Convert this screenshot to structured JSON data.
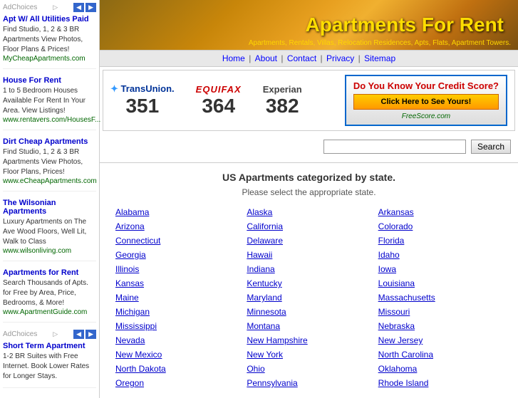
{
  "header": {
    "title": "Apartments For Rent",
    "subtitle": "Apartments, Rentals, Villas, Relocation Residences, Apts, Flats, Apartment Towers."
  },
  "navbar": {
    "items": [
      "Home",
      "About",
      "Contact",
      "Privacy",
      "Sitemap"
    ]
  },
  "credit": {
    "banner_title": "Do You Know Your Credit Score?",
    "cta_btn": "Click Here to See Yours!",
    "freescore": "FreeScore.com",
    "scores": [
      {
        "brand": "TransUnion.",
        "value": "351",
        "class": "transunion"
      },
      {
        "brand": "EQUIFAX",
        "value": "364",
        "class": "equifax"
      },
      {
        "brand": "Experian",
        "value": "382",
        "class": "experian"
      }
    ]
  },
  "search": {
    "placeholder": "",
    "button": "Search"
  },
  "states": {
    "title": "US Apartments categorized by state.",
    "subtitle": "Please select the appropriate state.",
    "list": [
      [
        "Alabama",
        "Alaska",
        "Arkansas"
      ],
      [
        "Arizona",
        "California",
        "Colorado"
      ],
      [
        "Connecticut",
        "Delaware",
        "Florida"
      ],
      [
        "Georgia",
        "Hawaii",
        "Idaho"
      ],
      [
        "Illinois",
        "Indiana",
        "Iowa"
      ],
      [
        "Kansas",
        "Kentucky",
        "Louisiana"
      ],
      [
        "Maine",
        "Maryland",
        "Massachusetts"
      ],
      [
        "Michigan",
        "Minnesota",
        "Missouri"
      ],
      [
        "Mississippi",
        "Montana",
        "Nebraska"
      ],
      [
        "Nevada",
        "New Hampshire",
        "New Jersey"
      ],
      [
        "New Mexico",
        "New York",
        "North Carolina"
      ],
      [
        "North Dakota",
        "Ohio",
        "Oklahoma"
      ],
      [
        "Oregon",
        "Pennsylvania",
        "Rhode Island"
      ]
    ]
  },
  "sidebar": {
    "adchoices_label": "AdChoices",
    "ads": [
      {
        "title": "Apt W/ All Utilities Paid",
        "text": "Find Studio, 1, 2 & 3 BR Apartments View Photos, Floor Plans & Prices!",
        "link": "MyCheapApartments.com"
      },
      {
        "title": "House For Rent",
        "text": "1 to 5 Bedroom Houses Available For Rent In Your Area. View Listings!",
        "link": "www.rentavers.com/HousesF..."
      },
      {
        "title": "Dirt Cheap Apartments",
        "text": "Find Studio, 1, 2 & 3 BR Apartments View Photos, Floor Plans, Prices!",
        "link": "www.eCheapApartments.com"
      },
      {
        "title": "The Wilsonian Apartments",
        "text": "Luxury Apartments on The Ave Wood Floors, Well Lit, Walk to Class",
        "link": "www.wilsonliving.com"
      },
      {
        "title": "Apartments for Rent",
        "text": "Search Thousands of Apts. for Free by Area, Price, Bedrooms, & More!",
        "link": "www.ApartmentGuide.com"
      }
    ],
    "ads2": [
      {
        "title": "Short Term Apartment",
        "text": "1-2 BR Suites with Free Internet. Book Lower Rates for Longer Stays.",
        "link": ""
      }
    ]
  }
}
